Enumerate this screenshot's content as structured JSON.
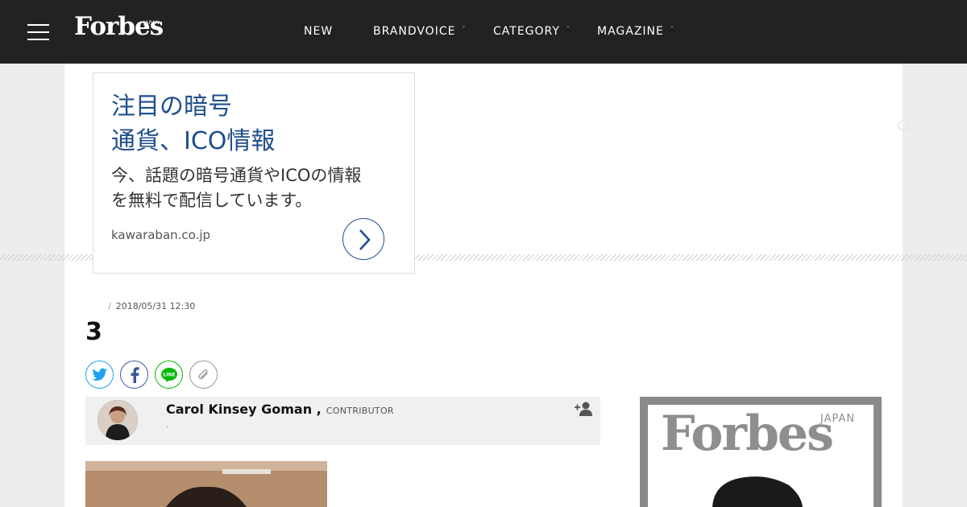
{
  "header": {
    "logo": "Forbes",
    "logo_sub": "JAPAN",
    "nav": [
      {
        "label": "NEW",
        "has_dropdown": false
      },
      {
        "label": "BRANDVOICE",
        "has_dropdown": true
      },
      {
        "label": "CATEGORY",
        "has_dropdown": true
      },
      {
        "label": "MAGAZINE",
        "has_dropdown": true
      }
    ],
    "caret": "ˇ"
  },
  "ad": {
    "title_line1": "注目の暗号",
    "title_line2": "通貨、ICO情報",
    "body_line1": "今、話題の暗号通貨やICOの情報",
    "body_line2": "を無料で配信しています。",
    "url": "kawaraban.co.jp",
    "accent": "#1f4e8c"
  },
  "article": {
    "meta_sep": "/",
    "date": "2018/05/31 12:30",
    "title": "3",
    "share": [
      "twitter-icon",
      "facebook-icon",
      "line-icon",
      "link-icon"
    ],
    "share_colors": {
      "twitter": "#1da1f2",
      "facebook": "#3b5998",
      "line": "#00b900",
      "link": "#999999"
    },
    "line_label": "LINE"
  },
  "author": {
    "name": "Carol Kinsey Goman ,",
    "role": "CONTRIBUTOR",
    "note": "."
  },
  "magazine": {
    "logo": "Forbes",
    "logo_sub": "JAPAN"
  }
}
